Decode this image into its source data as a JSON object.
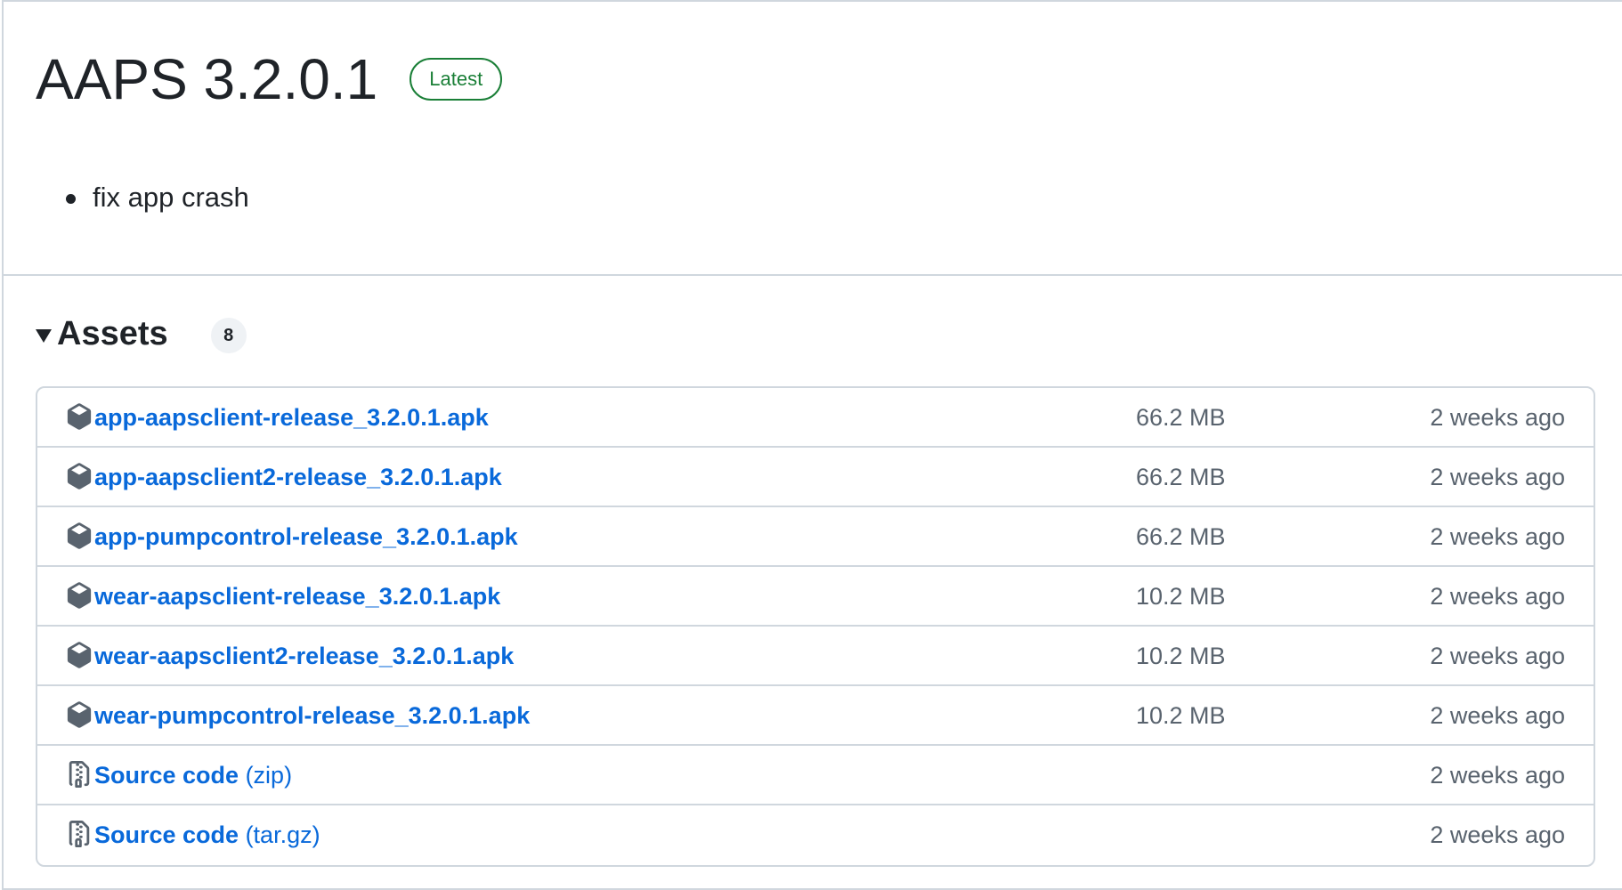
{
  "release": {
    "title": "AAPS 3.2.0.1",
    "badge": "Latest",
    "notes": [
      "fix app crash"
    ]
  },
  "assets": {
    "heading": "Assets",
    "count": "8",
    "items": [
      {
        "name": "app-aapsclient-release_3.2.0.1.apk",
        "suffix": "",
        "size": "66.2 MB",
        "time": "2 weeks ago",
        "icon": "package-icon"
      },
      {
        "name": "app-aapsclient2-release_3.2.0.1.apk",
        "suffix": "",
        "size": "66.2 MB",
        "time": "2 weeks ago",
        "icon": "package-icon"
      },
      {
        "name": "app-pumpcontrol-release_3.2.0.1.apk",
        "suffix": "",
        "size": "66.2 MB",
        "time": "2 weeks ago",
        "icon": "package-icon"
      },
      {
        "name": "wear-aapsclient-release_3.2.0.1.apk",
        "suffix": "",
        "size": "10.2 MB",
        "time": "2 weeks ago",
        "icon": "package-icon"
      },
      {
        "name": "wear-aapsclient2-release_3.2.0.1.apk",
        "suffix": "",
        "size": "10.2 MB",
        "time": "2 weeks ago",
        "icon": "package-icon"
      },
      {
        "name": "wear-pumpcontrol-release_3.2.0.1.apk",
        "suffix": "",
        "size": "10.2 MB",
        "time": "2 weeks ago",
        "icon": "package-icon"
      },
      {
        "name": "Source code",
        "suffix": " (zip)",
        "size": "",
        "time": "2 weeks ago",
        "icon": "file-zip-icon"
      },
      {
        "name": "Source code",
        "suffix": " (tar.gz)",
        "size": "",
        "time": "2 weeks ago",
        "icon": "file-zip-icon"
      }
    ]
  },
  "colors": {
    "link": "#0969da",
    "latest_badge": "#1a7f37",
    "muted_text": "#59636e",
    "border": "#d0d7de"
  }
}
